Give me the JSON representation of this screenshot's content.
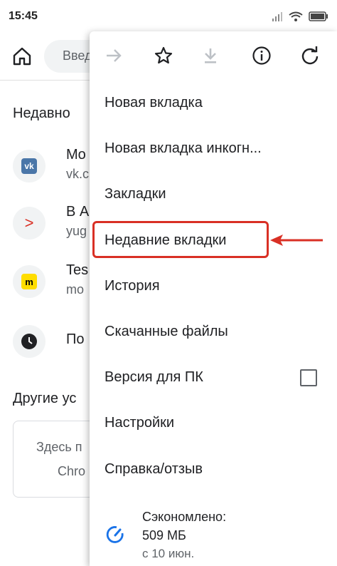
{
  "status_bar": {
    "time": "15:45"
  },
  "toolbar": {
    "omnibox_text": "Введ"
  },
  "page": {
    "recent_title": "Недавно",
    "items": [
      {
        "title": "Mo",
        "sub": "vk.c",
        "icon": "vk-icon"
      },
      {
        "title": "В А",
        "sub": "yug",
        "icon": "chevron-icon"
      },
      {
        "title": "Tes",
        "sub": "mo",
        "icon": "m-badge-icon"
      },
      {
        "title": "По",
        "sub": "",
        "icon": "clock-icon"
      }
    ],
    "other_devices_title": "Другие ус",
    "card_line1": "Здесь п",
    "card_line2": "Chro"
  },
  "menu": {
    "icons": [
      "forward-icon",
      "star-icon",
      "download-icon",
      "info-icon",
      "reload-icon"
    ],
    "items": [
      "Новая вкладка",
      "Новая вкладка инкогн...",
      "Закладки",
      "Недавние вкладки",
      "История",
      "Скачанные файлы",
      "Версия для ПК",
      "Настройки",
      "Справка/отзыв"
    ],
    "desktop_checked": false,
    "savings": {
      "line1": "Сэкономлено:",
      "line2": "509 МБ",
      "line3": "с 10 июн."
    }
  },
  "colors": {
    "highlight": "#d93025",
    "accent": "#1a73e8"
  }
}
